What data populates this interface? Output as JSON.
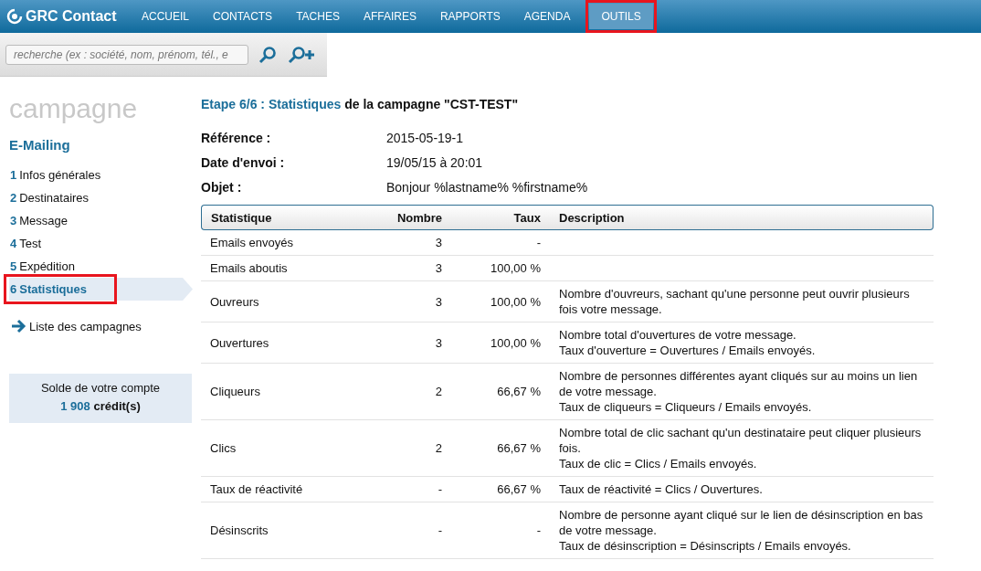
{
  "header": {
    "logo": "GRC Contact",
    "nav": [
      {
        "label": "ACCUEIL",
        "selected": false,
        "annotated": false
      },
      {
        "label": "CONTACTS",
        "selected": false,
        "annotated": false
      },
      {
        "label": "TACHES",
        "selected": false,
        "annotated": false
      },
      {
        "label": "AFFAIRES",
        "selected": false,
        "annotated": false
      },
      {
        "label": "RAPPORTS",
        "selected": false,
        "annotated": false
      },
      {
        "label": "AGENDA",
        "selected": false,
        "annotated": false
      },
      {
        "label": "OUTILS",
        "selected": true,
        "annotated": true
      }
    ]
  },
  "search": {
    "placeholder": "recherche (ex : société, nom, prénom, tél., e"
  },
  "sidebar": {
    "title": "campagne",
    "subtitle": "E-Mailing",
    "steps": [
      {
        "number": "1",
        "label": "Infos générales",
        "selected": false,
        "annotated": false
      },
      {
        "number": "2",
        "label": "Destinataires",
        "selected": false,
        "annotated": false
      },
      {
        "number": "3",
        "label": "Message",
        "selected": false,
        "annotated": false
      },
      {
        "number": "4",
        "label": "Test",
        "selected": false,
        "annotated": false
      },
      {
        "number": "5",
        "label": "Expédition",
        "selected": false,
        "annotated": false
      },
      {
        "number": "6",
        "label": "Statistiques",
        "selected": true,
        "annotated": true
      }
    ],
    "back_link": "Liste des campagnes",
    "balance": {
      "label": "Solde de votre compte",
      "amount": "1 908",
      "unit": "crédit(s)"
    }
  },
  "main": {
    "title_step": "Etape 6/6 : Statistiques",
    "title_rest": "de la campagne \"CST-TEST\"",
    "fields": [
      {
        "label": "Référence :",
        "value": "2015-05-19-1"
      },
      {
        "label": "Date d'envoi :",
        "value": "19/05/15 à 20:01"
      },
      {
        "label": "Objet :",
        "value": "Bonjour %lastname% %firstname%"
      }
    ],
    "table": {
      "columns": [
        "Statistique",
        "Nombre",
        "Taux",
        "Description"
      ],
      "rows": [
        {
          "name": "Emails envoyés",
          "count": "3",
          "rate": "-",
          "description": []
        },
        {
          "name": "Emails aboutis",
          "count": "3",
          "rate": "100,00 %",
          "description": []
        },
        {
          "name": "Ouvreurs",
          "count": "3",
          "rate": "100,00 %",
          "description": [
            "Nombre d'ouvreurs, sachant qu'une personne peut ouvrir plusieurs fois votre message."
          ]
        },
        {
          "name": "Ouvertures",
          "count": "3",
          "rate": "100,00 %",
          "description": [
            "Nombre total d'ouvertures de votre message.",
            "Taux d'ouverture = Ouvertures / Emails envoyés."
          ]
        },
        {
          "name": "Cliqueurs",
          "count": "2",
          "rate": "66,67 %",
          "description": [
            "Nombre de personnes différentes ayant cliqués sur au moins un lien de votre message.",
            "Taux de cliqueurs = Cliqueurs / Emails envoyés."
          ]
        },
        {
          "name": "Clics",
          "count": "2",
          "rate": "66,67 %",
          "description": [
            "Nombre total de clic sachant qu'un destinataire peut cliquer plusieurs fois.",
            "Taux de clic = Clics / Emails envoyés."
          ]
        },
        {
          "name": "Taux de réactivité",
          "count": "-",
          "rate": "66,67 %",
          "description": [
            "Taux de réactivité = Clics / Ouvertures."
          ]
        },
        {
          "name": "Désinscrits",
          "count": "-",
          "rate": "-",
          "description": [
            "Nombre de personne ayant cliqué sur le lien de désinscription en bas de votre message.",
            "Taux de désinscription = Désinscripts / Emails envoyés."
          ]
        }
      ]
    }
  }
}
